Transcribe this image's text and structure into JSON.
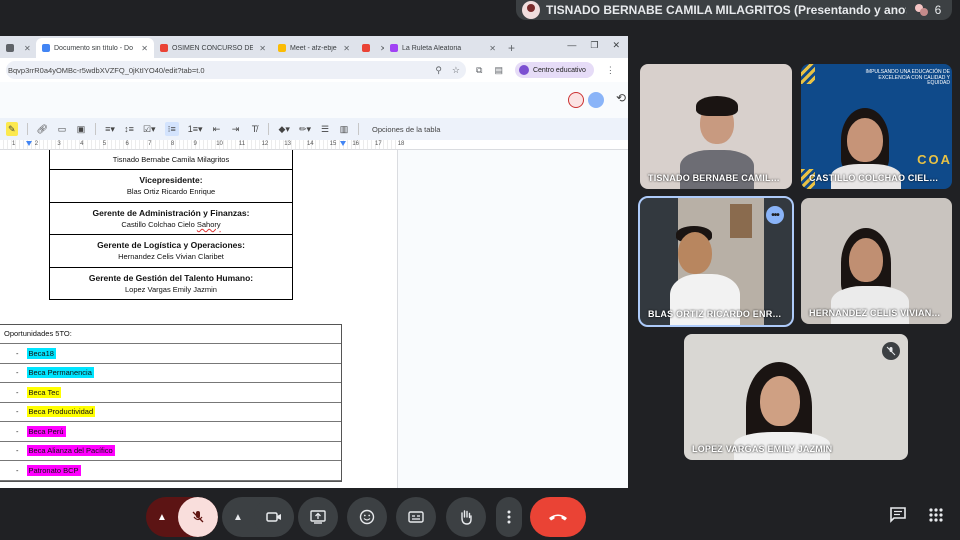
{
  "meet": {
    "presenter_text": "TISNADO BERNABE CAMILA MILAGRITOS (Presentando y anotando)",
    "participant_count": "6",
    "participants": [
      {
        "name": "TISNADO BERNABE CAMIL…"
      },
      {
        "name": "CASTILLO COLCHAO CIEL…"
      },
      {
        "name": "BLAS ORTIZ RICARDO ENR…"
      },
      {
        "name": "HERNANDEZ CELIS VIVIAN…"
      },
      {
        "name": "LOPEZ VARGAS EMILY JAZMIN"
      }
    ],
    "banner_text": "IMPULSANDO UNA EDUCACIÓN DE EXCELENCIA CON CALIDAD Y EQUIDAD",
    "banner_logo": "COA",
    "more_glyph": "•••"
  },
  "browser": {
    "tabs": [
      {
        "label": "O ▢",
        "color": "#5f6368"
      },
      {
        "label": "Documento sin título - Do",
        "color": "#4285f4",
        "active": true
      },
      {
        "label": "OSIMEN CONCURSO DE H",
        "color": "#ea4335"
      },
      {
        "label": "Meet - afz-ebje-vjn",
        "color": "#fbbc04"
      },
      {
        "label": "",
        "color": "#ea4335"
      },
      {
        "label": "La Ruleta Aleatoria",
        "color": "#a142f4"
      }
    ],
    "url": "Bqvp3rrR0a4yOMBc-r5wdbXVZFQ_0jKtIYO40/edit?tab=t.0",
    "edu_label": "Centro educativo",
    "table_options": "Opciones de la tabla",
    "ruler_numbers": [
      "1",
      "2",
      "3",
      "4",
      "5",
      "6",
      "7",
      "8",
      "9",
      "10",
      "11",
      "12",
      "13",
      "14",
      "15",
      "16",
      "17",
      "18"
    ]
  },
  "doc": {
    "org_chart": [
      {
        "role": "",
        "name": "Tisnado Bernabe Camila Milagritos"
      },
      {
        "role": "Vicepresidente:",
        "name": "Blas Ortiz Ricardo Enrique"
      },
      {
        "role": "Gerente de Administración y Finanzas:",
        "name_a": "Castillo Colchao Cielo ",
        "name_b": "Sahory"
      },
      {
        "role": "Gerente de Logística y Operaciones:",
        "name": "Hernandez Celis Vivian Claribet"
      },
      {
        "role": "Gerente de Gestión del Talento Humano:",
        "name": "Lopez Vargas Emily Jazmin"
      }
    ],
    "opportunities_title": "Oportunidades 5TO:",
    "opportunities": [
      {
        "label": "Beca18",
        "highlight": "#00e5ff"
      },
      {
        "label": "Beca Permanencia",
        "highlight": "#00e5ff"
      },
      {
        "label": "Beca Tec",
        "highlight": "#ffff00"
      },
      {
        "label": "Beca Productividad",
        "highlight": "#ffff00"
      },
      {
        "label": "Beca Perú",
        "highlight": "#ff00ff"
      },
      {
        "label": "Beca Alianza del Pacífico",
        "highlight": "#ff00ff"
      },
      {
        "label": "Patronato BCP",
        "highlight": "#ff00ff"
      }
    ]
  }
}
